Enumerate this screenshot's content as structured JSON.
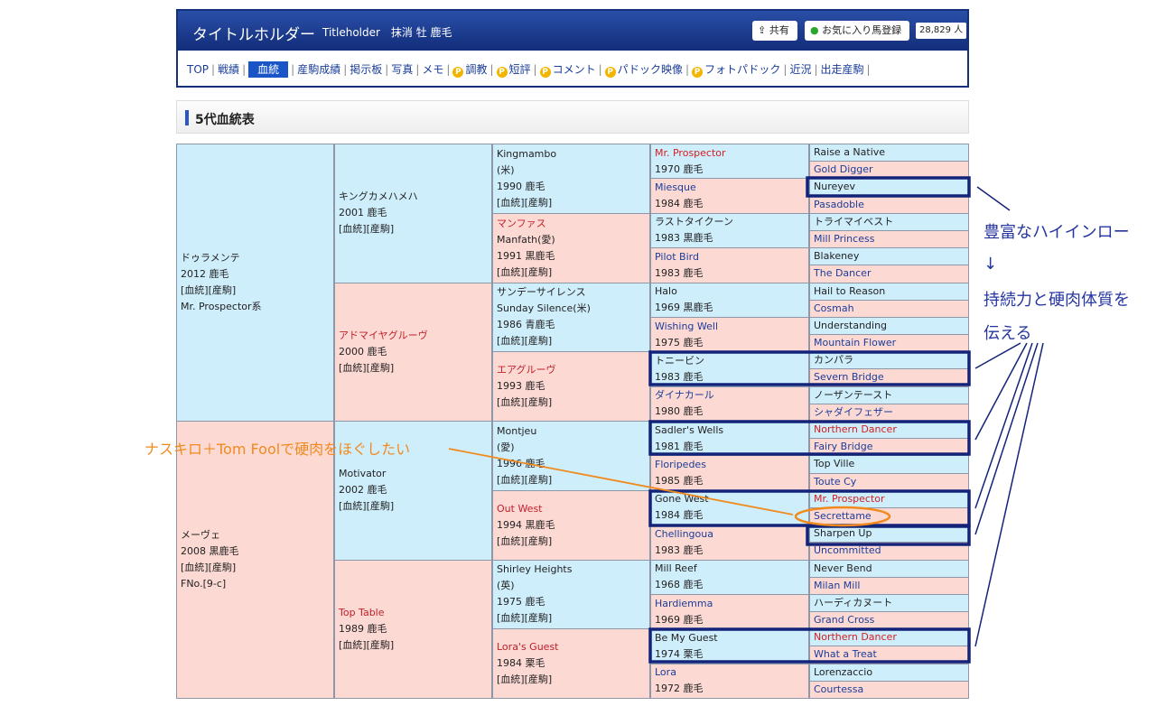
{
  "header": {
    "title": "タイトルホルダー",
    "subtitle": "Titleholder　抹消 牡 鹿毛",
    "share_label": "共有",
    "fav_label": "お気に入り馬登録",
    "fav_count": "28,829 人"
  },
  "nav": [
    {
      "label": "TOP",
      "active": false,
      "p": false
    },
    {
      "label": "戦績",
      "active": false,
      "p": false
    },
    {
      "label": "血統",
      "active": true,
      "p": false
    },
    {
      "label": "産駒成績",
      "active": false,
      "p": false
    },
    {
      "label": "掲示板",
      "active": false,
      "p": false
    },
    {
      "label": "写真",
      "active": false,
      "p": false
    },
    {
      "label": "メモ",
      "active": false,
      "p": false
    },
    {
      "label": "調教",
      "active": false,
      "p": true
    },
    {
      "label": "短評",
      "active": false,
      "p": true
    },
    {
      "label": "コメント",
      "active": false,
      "p": true
    },
    {
      "label": "パドック映像",
      "active": false,
      "p": true
    },
    {
      "label": "フォトパドック",
      "active": false,
      "p": true
    },
    {
      "label": "近況",
      "active": false,
      "p": false
    },
    {
      "label": "出走産駒",
      "active": false,
      "p": false
    }
  ],
  "section_title": "5代血統表",
  "pedigree": {
    "g1": [
      {
        "lines": [
          "ドゥラメンテ",
          "2012 鹿毛",
          "[血統][産駒]",
          "Mr. Prospector系"
        ],
        "sex": "m"
      },
      {
        "lines": [
          "メーヴェ",
          "2008 黒鹿毛",
          "[血統][産駒]",
          "FNo.[9-c]"
        ],
        "sex": "f"
      }
    ],
    "g2": [
      {
        "lines": [
          "キングカメハメハ",
          "2001 鹿毛",
          "[血統][産駒]"
        ],
        "sex": "m"
      },
      {
        "lines": [
          "アドマイヤグルーヴ",
          "2000 鹿毛",
          "[血統][産駒]"
        ],
        "sex": "f"
      },
      {
        "lines": [
          "Motivator",
          "2002 鹿毛",
          "[血統][産駒]"
        ],
        "sex": "m"
      },
      {
        "lines": [
          "Top Table",
          "1989 鹿毛",
          "[血統][産駒]"
        ],
        "sex": "f"
      }
    ],
    "g3": [
      {
        "lines": [
          "Kingmambo",
          "(米)",
          "1990 鹿毛",
          "[血統][産駒]"
        ],
        "sex": "m"
      },
      {
        "lines": [
          "マンファス",
          "Manfath(愛)",
          "1991 黒鹿毛",
          "[血統][産駒]"
        ],
        "sex": "f"
      },
      {
        "lines": [
          "サンデーサイレンス",
          "Sunday Silence(米)",
          "1986 青鹿毛",
          "[血統][産駒]"
        ],
        "sex": "m"
      },
      {
        "lines": [
          "エアグルーヴ",
          "1993 鹿毛",
          "[血統][産駒]"
        ],
        "sex": "f"
      },
      {
        "lines": [
          "Montjeu",
          "(愛)",
          "1996 鹿毛",
          "[血統][産駒]"
        ],
        "sex": "m"
      },
      {
        "lines": [
          "Out West",
          "1994 黒鹿毛",
          "[血統][産駒]"
        ],
        "sex": "f"
      },
      {
        "lines": [
          "Shirley Heights",
          "(英)",
          "1975 鹿毛",
          "[血統][産駒]"
        ],
        "sex": "m"
      },
      {
        "lines": [
          "Lora's Guest",
          "1984 栗毛",
          "[血統][産駒]"
        ],
        "sex": "f"
      }
    ],
    "g4": [
      {
        "name": "Mr. Prospector",
        "year": "1970 鹿毛",
        "sex": "m",
        "red": true
      },
      {
        "name": "Miesque",
        "year": "1984 鹿毛",
        "sex": "f",
        "red": false
      },
      {
        "name": "ラストタイクーン",
        "year": "1983 黒鹿毛",
        "sex": "m",
        "red": false
      },
      {
        "name": "Pilot Bird",
        "year": "1983 鹿毛",
        "sex": "f",
        "red": false
      },
      {
        "name": "Halo",
        "year": "1969 黒鹿毛",
        "sex": "m",
        "red": false
      },
      {
        "name": "Wishing Well",
        "year": "1975 鹿毛",
        "sex": "f",
        "red": false
      },
      {
        "name": "トニービン",
        "year": "1983 鹿毛",
        "sex": "m",
        "red": false
      },
      {
        "name": "ダイナカール",
        "year": "1980 鹿毛",
        "sex": "f",
        "red": false
      },
      {
        "name": "Sadler's Wells",
        "year": "1981 鹿毛",
        "sex": "m",
        "red": false
      },
      {
        "name": "Floripedes",
        "year": "1985 鹿毛",
        "sex": "f",
        "red": false
      },
      {
        "name": "Gone West",
        "year": "1984 鹿毛",
        "sex": "m",
        "red": false
      },
      {
        "name": "Chellingoua",
        "year": "1983 鹿毛",
        "sex": "f",
        "red": false
      },
      {
        "name": "Mill Reef",
        "year": "1968 鹿毛",
        "sex": "m",
        "red": false
      },
      {
        "name": "Hardiemma",
        "year": "1969 鹿毛",
        "sex": "f",
        "red": false
      },
      {
        "name": "Be My Guest",
        "year": "1974 栗毛",
        "sex": "m",
        "red": false
      },
      {
        "name": "Lora",
        "year": "1972 鹿毛",
        "sex": "f",
        "red": false
      }
    ],
    "g5": [
      {
        "name": "Raise a Native",
        "red": false
      },
      {
        "name": "Gold Digger",
        "red": false
      },
      {
        "name": "Nureyev",
        "red": false
      },
      {
        "name": "Pasadoble",
        "red": false
      },
      {
        "name": "トライマイベスト",
        "red": false
      },
      {
        "name": "Mill Princess",
        "red": false
      },
      {
        "name": "Blakeney",
        "red": false
      },
      {
        "name": "The Dancer",
        "red": false
      },
      {
        "name": "Hail to Reason",
        "red": false
      },
      {
        "name": "Cosmah",
        "red": false
      },
      {
        "name": "Understanding",
        "red": false
      },
      {
        "name": "Mountain Flower",
        "red": false
      },
      {
        "name": "カンパラ",
        "red": false
      },
      {
        "name": "Severn Bridge",
        "red": false
      },
      {
        "name": "ノーザンテースト",
        "red": false
      },
      {
        "name": "シャダイフェザー",
        "red": false
      },
      {
        "name": "Northern Dancer",
        "red": true
      },
      {
        "name": "Fairy Bridge",
        "red": false
      },
      {
        "name": "Top Ville",
        "red": false
      },
      {
        "name": "Toute Cy",
        "red": false
      },
      {
        "name": "Mr. Prospector",
        "red": true
      },
      {
        "name": "Secrettame",
        "red": false
      },
      {
        "name": "Sharpen Up",
        "red": false
      },
      {
        "name": "Uncommitted",
        "red": false
      },
      {
        "name": "Never Bend",
        "red": false
      },
      {
        "name": "Milan Mill",
        "red": false
      },
      {
        "name": "ハーディカヌート",
        "red": false
      },
      {
        "name": "Grand Cross",
        "red": false
      },
      {
        "name": "Northern Dancer",
        "red": true
      },
      {
        "name": "What a Treat",
        "red": false
      },
      {
        "name": "Lorenzaccio",
        "red": false
      },
      {
        "name": "Courtessa",
        "red": false
      }
    ]
  },
  "annotations": {
    "blue_line1": "豊富なハイインロー",
    "blue_arrow": "↓",
    "blue_line2": "持続力と硬肉体質を",
    "blue_line3": "伝える",
    "orange": "ナスキロ＋Tom Foolで硬肉をほぐしたい"
  },
  "colors": {
    "header_bg": "#16348a",
    "male_bg": "#cfeefc",
    "female_bg": "#fdd9d4",
    "highlight_red": "#d22020",
    "annotation_blue": "#13237a",
    "annotation_orange": "#f08a1d"
  }
}
